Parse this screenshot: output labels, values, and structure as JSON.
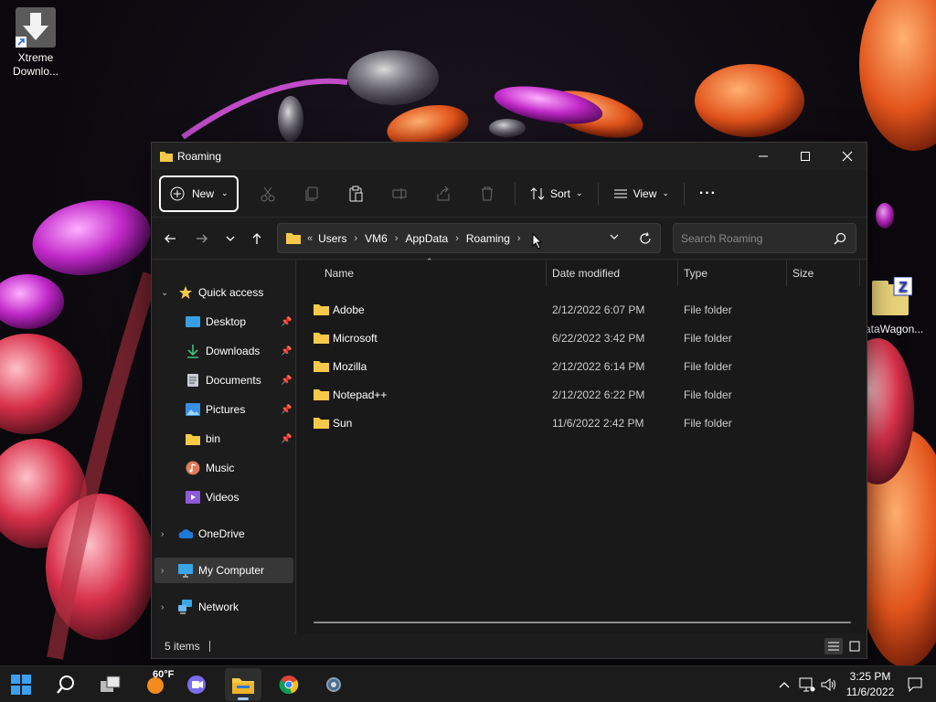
{
  "desktop": {
    "icons": [
      {
        "label": "Xtreme Downlo...",
        "icon": "download-arrow-icon"
      },
      {
        "label": "ataWagon...",
        "icon": "zip-folder-icon",
        "badge": "Z"
      }
    ]
  },
  "window": {
    "title": "Roaming",
    "controls": {
      "minimize": "—",
      "maximize": "☐",
      "close": "✕"
    }
  },
  "toolbar": {
    "new_label": "New",
    "sort_label": "Sort",
    "view_label": "View",
    "more_label": "···"
  },
  "address": {
    "overflow": "«",
    "crumbs": [
      "Users",
      "VM6",
      "AppData",
      "Roaming"
    ]
  },
  "search": {
    "placeholder": "Search Roaming"
  },
  "navpane": {
    "quick_access": "Quick access",
    "items": [
      {
        "label": "Desktop",
        "pinned": true
      },
      {
        "label": "Downloads",
        "pinned": true
      },
      {
        "label": "Documents",
        "pinned": true
      },
      {
        "label": "Pictures",
        "pinned": true
      },
      {
        "label": "bin",
        "pinned": true
      },
      {
        "label": "Music",
        "pinned": false
      },
      {
        "label": "Videos",
        "pinned": false
      }
    ],
    "onedrive": "OneDrive",
    "my_computer": "My Computer",
    "network": "Network"
  },
  "columns": {
    "name": "Name",
    "date": "Date modified",
    "type": "Type",
    "size": "Size"
  },
  "files": [
    {
      "name": "Adobe",
      "date": "2/12/2022 6:07 PM",
      "type": "File folder"
    },
    {
      "name": "Microsoft",
      "date": "6/22/2022 3:42 PM",
      "type": "File folder"
    },
    {
      "name": "Mozilla",
      "date": "2/12/2022 6:14 PM",
      "type": "File folder"
    },
    {
      "name": "Notepad++",
      "date": "2/12/2022 6:22 PM",
      "type": "File folder"
    },
    {
      "name": "Sun",
      "date": "11/6/2022 2:42 PM",
      "type": "File folder"
    }
  ],
  "status": {
    "items": "5 items"
  },
  "taskbar": {
    "weather": "60°F",
    "time": "3:25 PM",
    "date": "11/6/2022"
  },
  "colors": {
    "folder": "#f7c948",
    "accent": "#9ec9ff",
    "window_bg": "#1f1f1f"
  }
}
